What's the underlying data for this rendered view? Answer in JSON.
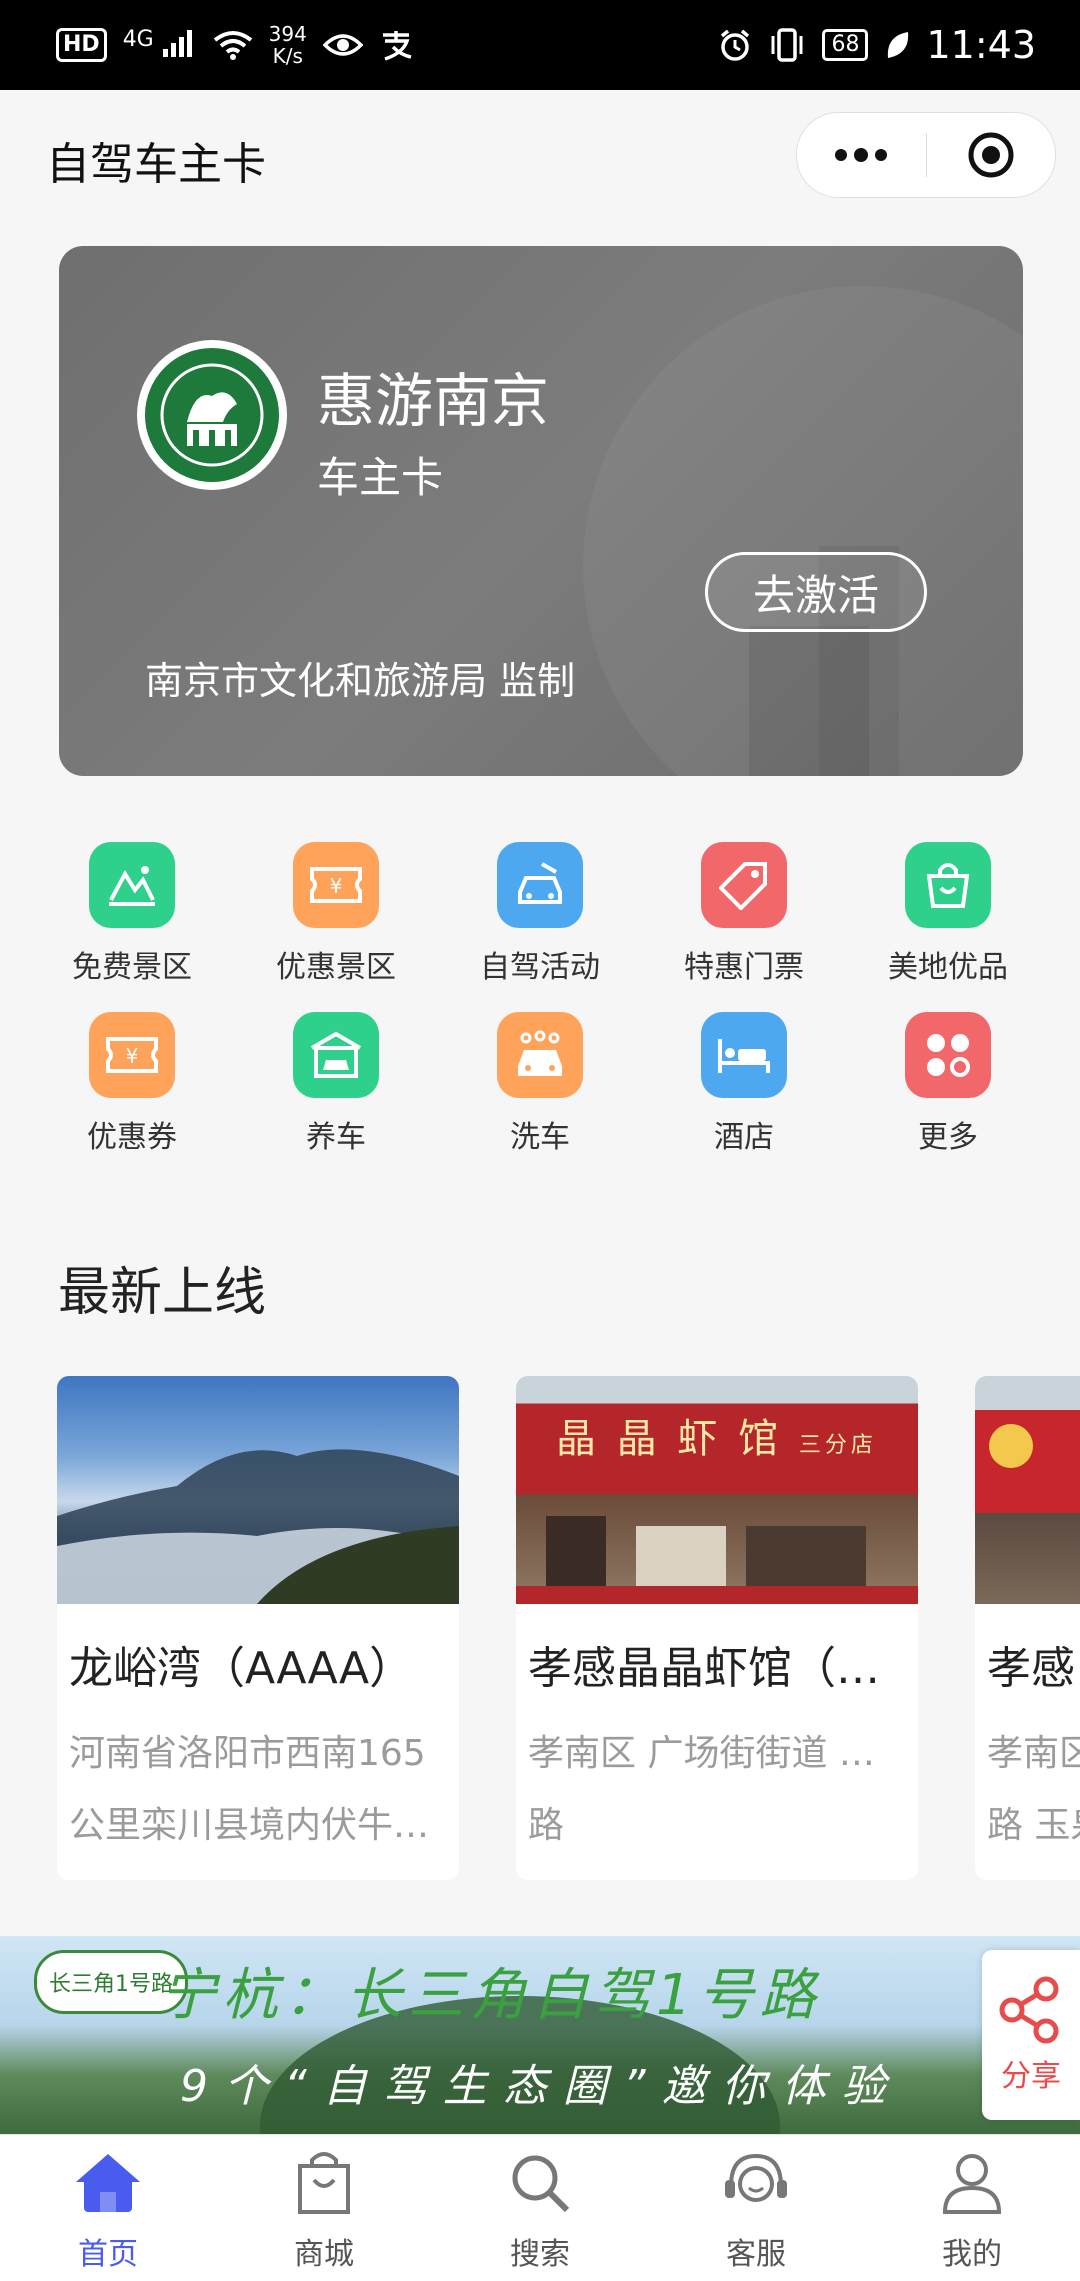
{
  "status_bar": {
    "hd": "HD",
    "network": "4G",
    "speed_value": "394",
    "speed_unit": "K/s",
    "battery": "68",
    "time": "11:43"
  },
  "header": {
    "title": "自驾车主卡"
  },
  "card": {
    "title": "惠游南京",
    "subtitle": "车主卡",
    "activate_label": "去激活",
    "footer": "南京市文化和旅游局 监制"
  },
  "grid": [
    {
      "label": "免费景区",
      "icon": "mountain-icon",
      "color": "#2fcf8c"
    },
    {
      "label": "优惠景区",
      "icon": "ticket-icon",
      "color": "#ffa25a"
    },
    {
      "label": "自驾活动",
      "icon": "car-icon",
      "color": "#4da8f0"
    },
    {
      "label": "特惠门票",
      "icon": "tag-icon",
      "color": "#f2686a"
    },
    {
      "label": "美地优品",
      "icon": "shopping-bag-icon",
      "color": "#2fcf8c"
    },
    {
      "label": "优惠券",
      "icon": "coupon-icon",
      "color": "#ffa25a"
    },
    {
      "label": "养车",
      "icon": "garage-icon",
      "color": "#2fcf8c"
    },
    {
      "label": "洗车",
      "icon": "car-wash-icon",
      "color": "#ffa25a"
    },
    {
      "label": "酒店",
      "icon": "bed-icon",
      "color": "#4da8f0"
    },
    {
      "label": "更多",
      "icon": "more-grid-icon",
      "color": "#f2686a"
    }
  ],
  "section": {
    "title": "最新上线"
  },
  "items": [
    {
      "title": "龙峪湾（AAAA）",
      "desc_line1": "河南省洛阳市西南165",
      "desc_line2": "公里栾川县境内伏牛…"
    },
    {
      "title": "孝感晶晶虾馆（…",
      "desc_line1": "孝南区 广场街街道 天仙",
      "desc_line2": "路",
      "sign": "晶 晶 虾 馆",
      "sign_sub": "三分店"
    },
    {
      "title": "孝感",
      "desc_line1": "孝南区",
      "desc_line2": "路 玉泉"
    }
  ],
  "banner": {
    "badge": "长三角1号路",
    "title": "宁杭：长三角自驾1号路",
    "subtitle": "9个“自驾生态圈”邀你体验"
  },
  "share": {
    "label": "分享"
  },
  "tabs": [
    {
      "label": "首页",
      "icon": "home-icon",
      "active": true
    },
    {
      "label": "商城",
      "icon": "shopping-bag-icon",
      "active": false
    },
    {
      "label": "搜索",
      "icon": "search-icon",
      "active": false
    },
    {
      "label": "客服",
      "icon": "headset-icon",
      "active": false
    },
    {
      "label": "我的",
      "icon": "user-icon",
      "active": false
    }
  ],
  "colors": {
    "accent": "#4a5cf0",
    "share_red": "#e84b4b"
  }
}
